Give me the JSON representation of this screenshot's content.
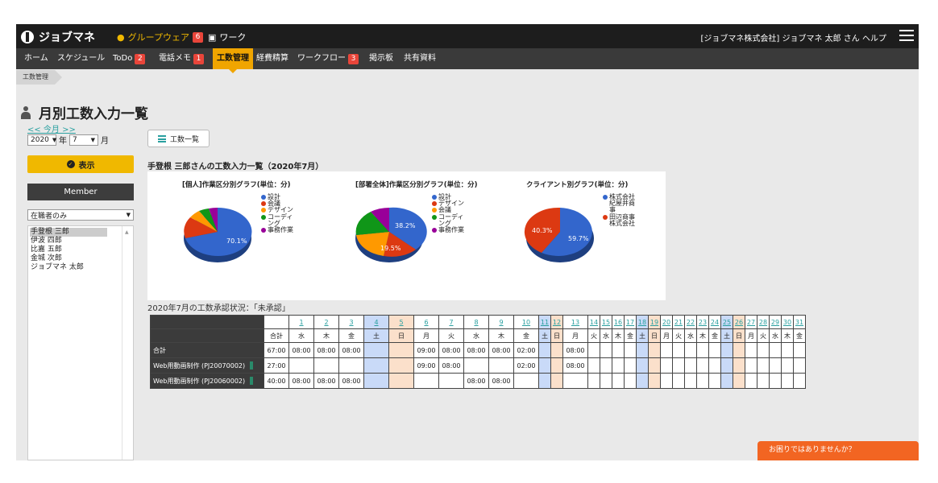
{
  "app": {
    "logo": "ジョブマネ",
    "groupware": "グループウェア",
    "groupware_badge": "6",
    "work": "ワーク",
    "user_info": "[ジョブマネ株式会社] ジョブマネ 太郎 さん",
    "help": "ヘルプ"
  },
  "nav": [
    {
      "label": "ホーム"
    },
    {
      "label": "スケジュール"
    },
    {
      "label": "ToDo",
      "badge": "2"
    },
    {
      "label": "電話メモ",
      "badge": "1"
    },
    {
      "label": "工数管理"
    },
    {
      "label": "経費精算"
    },
    {
      "label": "ワークフロー",
      "badge": "3"
    },
    {
      "label": "掲示板"
    },
    {
      "label": "共有資料"
    }
  ],
  "breadcrumb": "工数管理",
  "page_title": "月別工数入力一覧",
  "month_nav": "<< 今月 >>",
  "year": "2020",
  "year_suffix": "年",
  "month": "7",
  "month_suffix": "月",
  "show_button": "表示",
  "member_header": "Member",
  "member_filter": "在職者のみ",
  "members": [
    "手登根 三郎",
    "伊波 四郎",
    "比嘉 五郎",
    "金城 次郎",
    "ジョブマネ 太郎"
  ],
  "list_button": "工数一覧",
  "subtitle": "手登根 三郎さんの工数入力一覧（2020年7月）",
  "charts": [
    {
      "title": "[個人]作業区分別グラフ(単位：分)",
      "legend": [
        {
          "label": "設計",
          "color": "#3366cc"
        },
        {
          "label": "会議",
          "color": "#dc3912"
        },
        {
          "label": "デザイン",
          "color": "#ff9900"
        },
        {
          "label": "コーディ ング",
          "color": "#109618"
        },
        {
          "label": "事務作業",
          "color": "#990099"
        }
      ],
      "label": "70.1%"
    },
    {
      "title": "[部署全体]作業区分別グラフ(単位：分)",
      "legend": [
        {
          "label": "設計",
          "color": "#3366cc"
        },
        {
          "label": "デザイン",
          "color": "#dc3912"
        },
        {
          "label": "会議",
          "color": "#ff9900"
        },
        {
          "label": "コーディ ング",
          "color": "#109618"
        },
        {
          "label": "事務作業",
          "color": "#990099"
        }
      ],
      "label_a": "38.2%",
      "label_b": "19.5%"
    },
    {
      "title": "クライアント別グラフ(単位：分)",
      "legend": [
        {
          "label": "株式会社 紀屋井商 事",
          "color": "#3366cc"
        },
        {
          "label": "田辺商事 株式会社",
          "color": "#dc3912"
        }
      ],
      "label_a": "40.3%",
      "label_b": "59.7%"
    }
  ],
  "approval_status": "2020年7月の工数承認状況：「未承認」",
  "table": {
    "days": [
      "1",
      "2",
      "3",
      "4",
      "5",
      "6",
      "7",
      "8",
      "9",
      "10",
      "11",
      "12",
      "13",
      "14",
      "15",
      "16",
      "17",
      "18",
      "19",
      "20",
      "21",
      "22",
      "23",
      "24",
      "25",
      "26",
      "27",
      "28",
      "29",
      "30",
      "31"
    ],
    "total_header": "合計",
    "weekdays": [
      "水",
      "木",
      "金",
      "土",
      "日",
      "月",
      "火",
      "水",
      "木",
      "金",
      "土",
      "日",
      "月",
      "火",
      "水",
      "木",
      "金",
      "土",
      "日",
      "月",
      "火",
      "水",
      "木",
      "金",
      "土",
      "日",
      "月",
      "火",
      "水",
      "木",
      "金"
    ],
    "rows": [
      {
        "name": "合計",
        "total": "67:00",
        "vals": [
          "08:00",
          "08:00",
          "08:00",
          "",
          "",
          "09:00",
          "08:00",
          "08:00",
          "08:00",
          "02:00",
          "",
          "",
          "08:00"
        ]
      },
      {
        "name": "Web用動画制作 (PJ20070002)",
        "total": "27:00",
        "vals": [
          "",
          "",
          "",
          "",
          "",
          "09:00",
          "08:00",
          "",
          "",
          "02:00",
          "",
          "",
          "08:00"
        ]
      },
      {
        "name": "Web用動画制作 (PJ20060002)",
        "total": "40:00",
        "vals": [
          "08:00",
          "08:00",
          "08:00",
          "",
          "",
          "",
          "",
          "08:00",
          "08:00",
          "",
          "",
          "",
          ""
        ]
      }
    ]
  },
  "help_bar": "お困りではありませんか？"
}
